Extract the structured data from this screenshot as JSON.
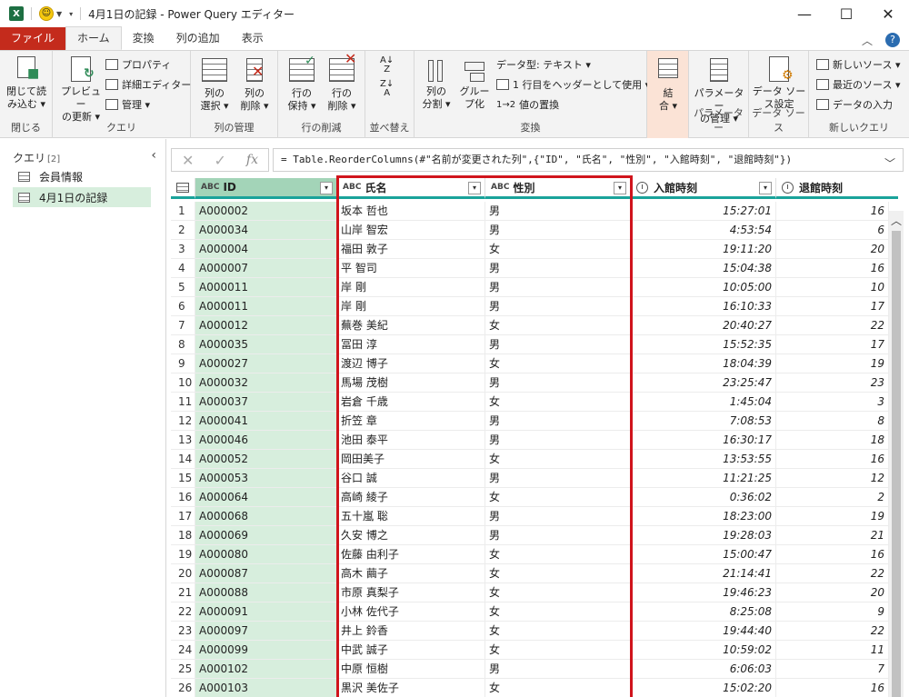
{
  "window": {
    "title": "4月1日の記録 - Power Query エディター",
    "app_badge": "X",
    "minimize": "—",
    "maximize": "☐",
    "close": "✕"
  },
  "ribbon_tabs": [
    {
      "label": "ファイル"
    },
    {
      "label": "ホーム"
    },
    {
      "label": "変換"
    },
    {
      "label": "列の追加"
    },
    {
      "label": "表示"
    }
  ],
  "ribbon": {
    "close": {
      "btn": "閉じて読\nみ込む ▾",
      "group": "閉じる"
    },
    "query": {
      "preview": "プレビュー\nの更新 ▾",
      "properties": "プロパティ",
      "advanced": "詳細エディター",
      "manage": "管理 ▾",
      "group": "クエリ"
    },
    "columns": {
      "select": "列の\n選択 ▾",
      "remove": "列の\n削除 ▾",
      "group": "列の管理"
    },
    "rows": {
      "keep": "行の\n保持 ▾",
      "remove": "行の\n削除 ▾",
      "group": "行の削減"
    },
    "sort": {
      "group": "並べ替え"
    },
    "transform": {
      "split": "列の\n分割 ▾",
      "group_by": "グルー\nプ化",
      "datatype": "データ型: テキスト ▾",
      "header": "1 行目をヘッダーとして使用 ▾",
      "replace": "値の置換",
      "group": "変換"
    },
    "combine": {
      "label": "結\n合 ▾",
      "group": ""
    },
    "params": {
      "manage": "パラメーター\nの管理 ▾",
      "group": "パラメーター"
    },
    "datasource": {
      "settings": "データ ソー\nス設定",
      "group": "データ ソース"
    },
    "newquery": {
      "new_source": "新しいソース ▾",
      "recent": "最近のソース ▾",
      "enter": "データの入力",
      "group": "新しいクエリ"
    }
  },
  "queries_pane": {
    "title": "クエリ",
    "count": "[2]",
    "items": [
      {
        "label": "会員情報"
      },
      {
        "label": "4月1日の記録"
      }
    ]
  },
  "formula_bar": {
    "formula": "= Table.ReorderColumns(#\"名前が変更された列\",{\"ID\", \"氏名\", \"性別\", \"入館時刻\", \"退館時刻\"})"
  },
  "columns": [
    {
      "name": "ID",
      "type": "ABC"
    },
    {
      "name": "氏名",
      "type": "ABC"
    },
    {
      "name": "性別",
      "type": "ABC"
    },
    {
      "name": "入館時刻",
      "type": "time"
    },
    {
      "name": "退館時刻",
      "type": "time"
    }
  ],
  "rows": [
    {
      "n": "1",
      "id": "A000002",
      "name": "坂本 哲也",
      "sex": "男",
      "in": "15:27:01",
      "out": "16"
    },
    {
      "n": "2",
      "id": "A000034",
      "name": "山岸 智宏",
      "sex": "男",
      "in": "4:53:54",
      "out": "6"
    },
    {
      "n": "3",
      "id": "A000004",
      "name": "福田 敦子",
      "sex": "女",
      "in": "19:11:20",
      "out": "20"
    },
    {
      "n": "4",
      "id": "A000007",
      "name": "平 智司",
      "sex": "男",
      "in": "15:04:38",
      "out": "16"
    },
    {
      "n": "5",
      "id": "A000011",
      "name": "岸 剛",
      "sex": "男",
      "in": "10:05:00",
      "out": "10"
    },
    {
      "n": "6",
      "id": "A000011",
      "name": "岸 剛",
      "sex": "男",
      "in": "16:10:33",
      "out": "17"
    },
    {
      "n": "7",
      "id": "A000012",
      "name": "蕪巻 美紀",
      "sex": "女",
      "in": "20:40:27",
      "out": "22"
    },
    {
      "n": "8",
      "id": "A000035",
      "name": "冨田 淳",
      "sex": "男",
      "in": "15:52:35",
      "out": "17"
    },
    {
      "n": "9",
      "id": "A000027",
      "name": "渡辺 博子",
      "sex": "女",
      "in": "18:04:39",
      "out": "19"
    },
    {
      "n": "10",
      "id": "A000032",
      "name": "馬場 茂樹",
      "sex": "男",
      "in": "23:25:47",
      "out": "23"
    },
    {
      "n": "11",
      "id": "A000037",
      "name": "岩倉 千歳",
      "sex": "女",
      "in": "1:45:04",
      "out": "3"
    },
    {
      "n": "12",
      "id": "A000041",
      "name": "折笠 章",
      "sex": "男",
      "in": "7:08:53",
      "out": "8"
    },
    {
      "n": "13",
      "id": "A000046",
      "name": "池田 泰平",
      "sex": "男",
      "in": "16:30:17",
      "out": "18"
    },
    {
      "n": "14",
      "id": "A000052",
      "name": "岡田美子",
      "sex": "女",
      "in": "13:53:55",
      "out": "16"
    },
    {
      "n": "15",
      "id": "A000053",
      "name": "谷口 誠",
      "sex": "男",
      "in": "11:21:25",
      "out": "12"
    },
    {
      "n": "16",
      "id": "A000064",
      "name": "高崎 綾子",
      "sex": "女",
      "in": "0:36:02",
      "out": "2"
    },
    {
      "n": "17",
      "id": "A000068",
      "name": "五十嵐 聡",
      "sex": "男",
      "in": "18:23:00",
      "out": "19"
    },
    {
      "n": "18",
      "id": "A000069",
      "name": "久安 博之",
      "sex": "男",
      "in": "19:28:03",
      "out": "21"
    },
    {
      "n": "19",
      "id": "A000080",
      "name": "佐藤 由利子",
      "sex": "女",
      "in": "15:00:47",
      "out": "16"
    },
    {
      "n": "20",
      "id": "A000087",
      "name": "高木 繭子",
      "sex": "女",
      "in": "21:14:41",
      "out": "22"
    },
    {
      "n": "21",
      "id": "A000088",
      "name": "市原 真梨子",
      "sex": "女",
      "in": "19:46:23",
      "out": "20"
    },
    {
      "n": "22",
      "id": "A000091",
      "name": "小林 佐代子",
      "sex": "女",
      "in": "8:25:08",
      "out": "9"
    },
    {
      "n": "23",
      "id": "A000097",
      "name": "井上 鈴香",
      "sex": "女",
      "in": "19:44:40",
      "out": "22"
    },
    {
      "n": "24",
      "id": "A000099",
      "name": "中武 誠子",
      "sex": "女",
      "in": "10:59:02",
      "out": "11"
    },
    {
      "n": "25",
      "id": "A000102",
      "name": "中原 恒樹",
      "sex": "男",
      "in": "6:06:03",
      "out": "7"
    },
    {
      "n": "26",
      "id": "A000103",
      "name": "黒沢 美佐子",
      "sex": "女",
      "in": "15:02:20",
      "out": "16"
    }
  ],
  "colors": {
    "file_tab": "#c42b1c",
    "selected_column": "#d7eedd",
    "header_accent": "#1aa39a",
    "highlight_box": "#d0141c"
  }
}
